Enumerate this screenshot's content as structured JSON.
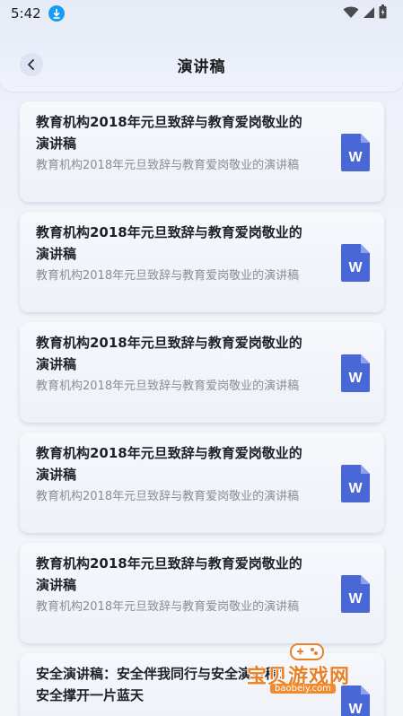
{
  "status_bar": {
    "time": "5:42"
  },
  "header": {
    "title": "演讲稿"
  },
  "items": [
    {
      "title": "教育机构2018年元旦致辞与教育爱岗敬业的演讲稿",
      "desc": "教育机构2018年元旦致辞与教育爱岗敬业的演讲稿"
    },
    {
      "title": "教育机构2018年元旦致辞与教育爱岗敬业的演讲稿",
      "desc": "教育机构2018年元旦致辞与教育爱岗敬业的演讲稿"
    },
    {
      "title": "教育机构2018年元旦致辞与教育爱岗敬业的演讲稿",
      "desc": "教育机构2018年元旦致辞与教育爱岗敬业的演讲稿"
    },
    {
      "title": "教育机构2018年元旦致辞与教育爱岗敬业的演讲稿",
      "desc": "教育机构2018年元旦致辞与教育爱岗敬业的演讲稿"
    },
    {
      "title": "教育机构2018年元旦致辞与教育爱岗敬业的演讲稿",
      "desc": "教育机构2018年元旦致辞与教育爱岗敬业的演讲稿"
    },
    {
      "title": "安全演讲稿：安全伴我同行与安全演讲稿：安全撑开一片蓝天",
      "desc": ""
    }
  ],
  "doc_icon_letter": "W",
  "watermark": {
    "text": "宝贝游戏网",
    "url": "baobeiy.com"
  },
  "colors": {
    "doc_icon": "#4a67d6",
    "accent_download": "#1a9df0",
    "watermark": "#e8822a"
  },
  "icons": [
    "download-icon",
    "wifi-icon",
    "signal-icon",
    "battery-icon",
    "back-chevron-icon",
    "word-doc-icon",
    "gamepad-icon"
  ]
}
